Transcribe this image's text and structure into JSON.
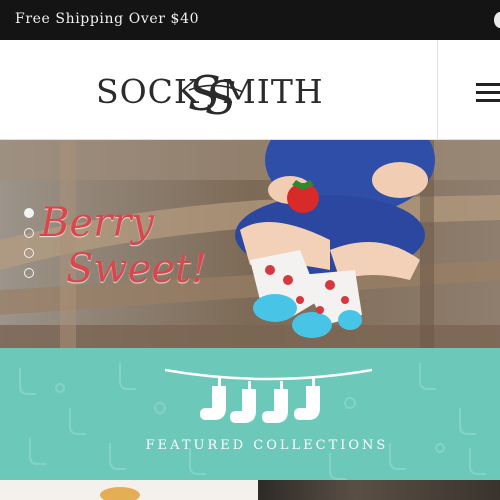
{
  "announcement": {
    "text": "Free Shipping Over $40"
  },
  "header": {
    "logo_left": "SOCK",
    "logo_right": "MITH",
    "logo_alt": "SOCKSMITH"
  },
  "hero": {
    "headline_line1": "Berry",
    "headline_line2": "Sweet!",
    "slide_count": 4,
    "active_slide": 1
  },
  "featured": {
    "title": "FEATURED COLLECTIONS"
  },
  "colors": {
    "topbar": "#141414",
    "accent_red": "#d8474e",
    "teal": "#6cc8b8"
  }
}
